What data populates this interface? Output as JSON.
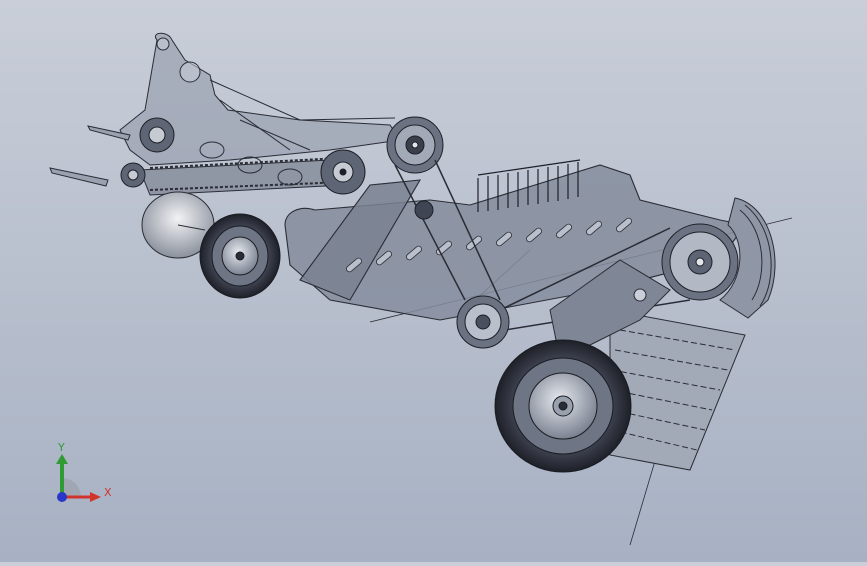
{
  "viewport": {
    "background_top": "#c9ced8",
    "background_bottom": "#a7b1c3",
    "model_line_color": "#2a2d35",
    "model_fill_color": "#7f8797"
  },
  "triad": {
    "x_label": "X",
    "y_label": "Y",
    "x_color": "#d0342c",
    "y_color": "#2e9b34",
    "z_color": "#2836c9"
  }
}
